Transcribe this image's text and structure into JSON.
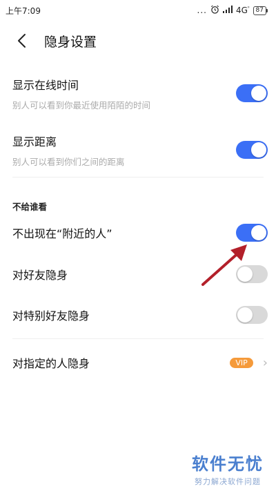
{
  "status_bar": {
    "time": "上午7:09",
    "dots": "...",
    "network": "4G",
    "network_sup": "ᴵᴵ",
    "battery": "87"
  },
  "header": {
    "title": "隐身设置",
    "back_icon": "chevron-left-icon"
  },
  "settings": [
    {
      "title": "显示在线时间",
      "subtitle": "别人可以看到你最近使用陌陌的时间",
      "toggle": "on"
    },
    {
      "title": "显示距离",
      "subtitle": "别人可以看到你们之间的距离",
      "toggle": "on"
    }
  ],
  "section": {
    "header": "不给谁看",
    "items": [
      {
        "title": "不出现在“附近的人”",
        "toggle": "on"
      },
      {
        "title": "对好友隐身",
        "toggle": "off"
      },
      {
        "title": "对特别好友隐身",
        "toggle": "off"
      },
      {
        "title": "对指定的人隐身",
        "badge": "VIP",
        "chevron": "chevron-right-icon"
      }
    ]
  },
  "colors": {
    "toggle_on": "#3b6ff6",
    "toggle_off": "#d9d9d9",
    "vip": "#f59a3a",
    "annotation_arrow": "#b3202a"
  },
  "watermark": {
    "main": "软件无忧",
    "sub": "努力解决软件问题"
  }
}
